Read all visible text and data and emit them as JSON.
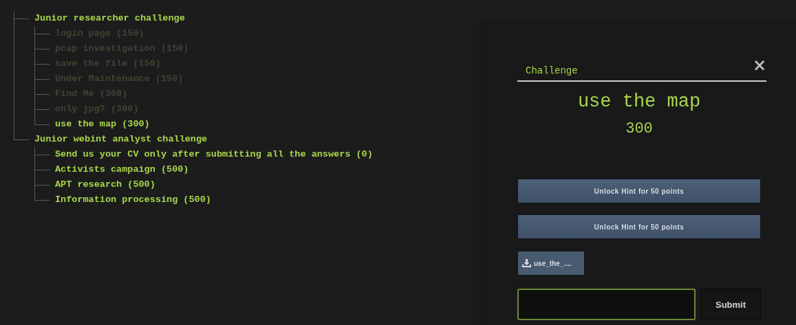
{
  "tree": [
    {
      "label": "Junior researcher challenge",
      "children": [
        {
          "label": "login page (150)",
          "solved": true
        },
        {
          "label": "pcap investigation (150)",
          "solved": true
        },
        {
          "label": "save the file (150)",
          "solved": true
        },
        {
          "label": "Under Maintenance (150)",
          "solved": true
        },
        {
          "label": "Find Me (300)",
          "solved": true
        },
        {
          "label": "only jpg? (300)",
          "solved": true
        },
        {
          "label": "use the map (300)",
          "solved": false
        }
      ]
    },
    {
      "label": "Junior webint analyst challenge",
      "children": [
        {
          "label": "Send us your CV only after submitting all the answers (0)",
          "solved": false
        },
        {
          "label": "Activists campaign (500)",
          "solved": false
        },
        {
          "label": "APT research (500)",
          "solved": false
        },
        {
          "label": "Information processing (500)",
          "solved": false
        }
      ]
    }
  ],
  "modal": {
    "header": "Challenge",
    "close": "×",
    "title": "use the map",
    "points": "300",
    "hints": [
      "Unlock Hint for 50 points",
      "Unlock Hint for 50 points"
    ],
    "file": "use_the_....",
    "submit": "Submit"
  }
}
